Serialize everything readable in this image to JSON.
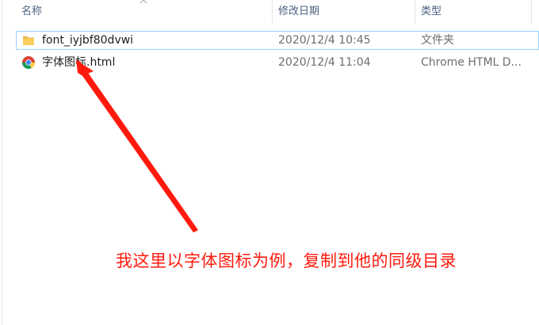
{
  "columns": {
    "name": "名称",
    "modified": "修改日期",
    "type": "类型"
  },
  "files": [
    {
      "name": "font_iyjbf80dvwi",
      "modified": "2020/12/4 10:45",
      "type": "文件夹",
      "icon": "folder-icon",
      "selected": true
    },
    {
      "name": "字体图标.html",
      "modified": "2020/12/4 11:04",
      "type": "Chrome HTML D...",
      "icon": "chrome-icon",
      "selected": false
    }
  ],
  "annotation": {
    "text": "我这里以字体图标为例，复制到他的同级目录",
    "color": "#ff1a0d"
  }
}
